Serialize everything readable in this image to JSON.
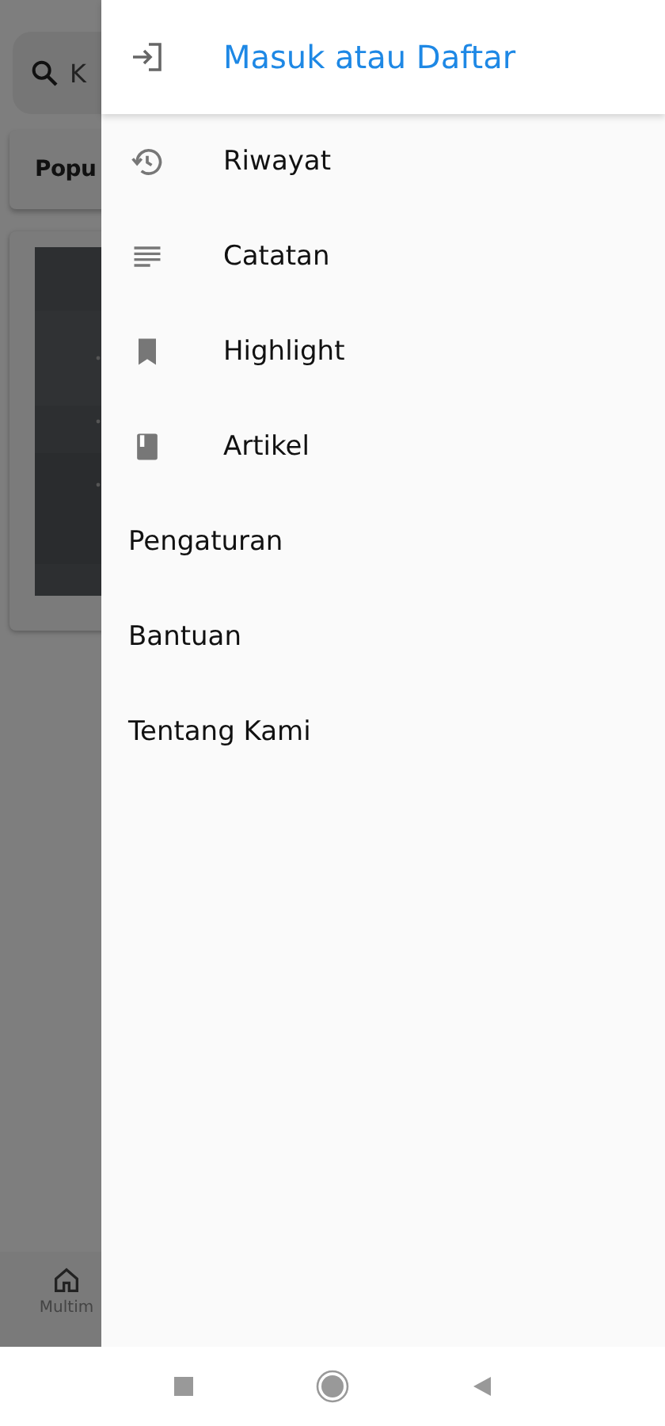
{
  "background_page": {
    "search": {
      "placeholder": "K"
    },
    "section_title": "Popu",
    "bottom_nav": [
      {
        "label": "Multim"
      }
    ]
  },
  "drawer": {
    "header": {
      "label": "Masuk atau Daftar"
    },
    "items": [
      {
        "kind": "icon",
        "label": "Riwayat"
      },
      {
        "kind": "icon",
        "label": "Catatan"
      },
      {
        "kind": "icon",
        "label": "Highlight"
      },
      {
        "kind": "icon",
        "label": "Artikel"
      },
      {
        "kind": "plain",
        "label": "Pengaturan"
      },
      {
        "kind": "plain",
        "label": "Bantuan"
      },
      {
        "kind": "plain",
        "label": "Tentang Kami"
      }
    ]
  }
}
